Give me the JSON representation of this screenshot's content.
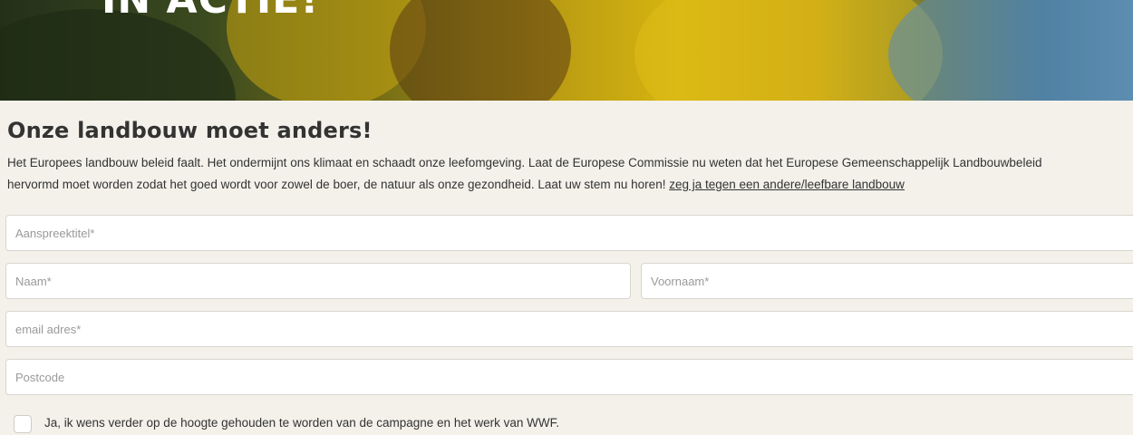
{
  "hero": {
    "title": "IN ACTIE!"
  },
  "section": {
    "heading": "Onze landbouw moet anders!",
    "intro_line1": "Het Europees landbouw beleid faalt. Het ondermijnt ons klimaat en schaadt onze leefomgeving. Laat de Europese Commissie nu weten dat het Europese Gemeenschappelijk Landbouwbeleid",
    "intro_line2": "hervormd moet worden zodat het goed wordt voor zowel de boer, de natuur als onze gezondheid. Laat uw stem nu horen!",
    "intro_link": "zeg ja tegen een andere/leefbare landbouw"
  },
  "form": {
    "title_placeholder": "Aanspreektitel*",
    "lastname_placeholder": "Naam*",
    "firstname_placeholder": "Voornaam*",
    "email_placeholder": "email adres*",
    "postcode_placeholder": "Postcode",
    "newsletter_label": "Ja, ik wens verder op de hoogte gehouden te worden van de campagne en het werk van WWF."
  }
}
